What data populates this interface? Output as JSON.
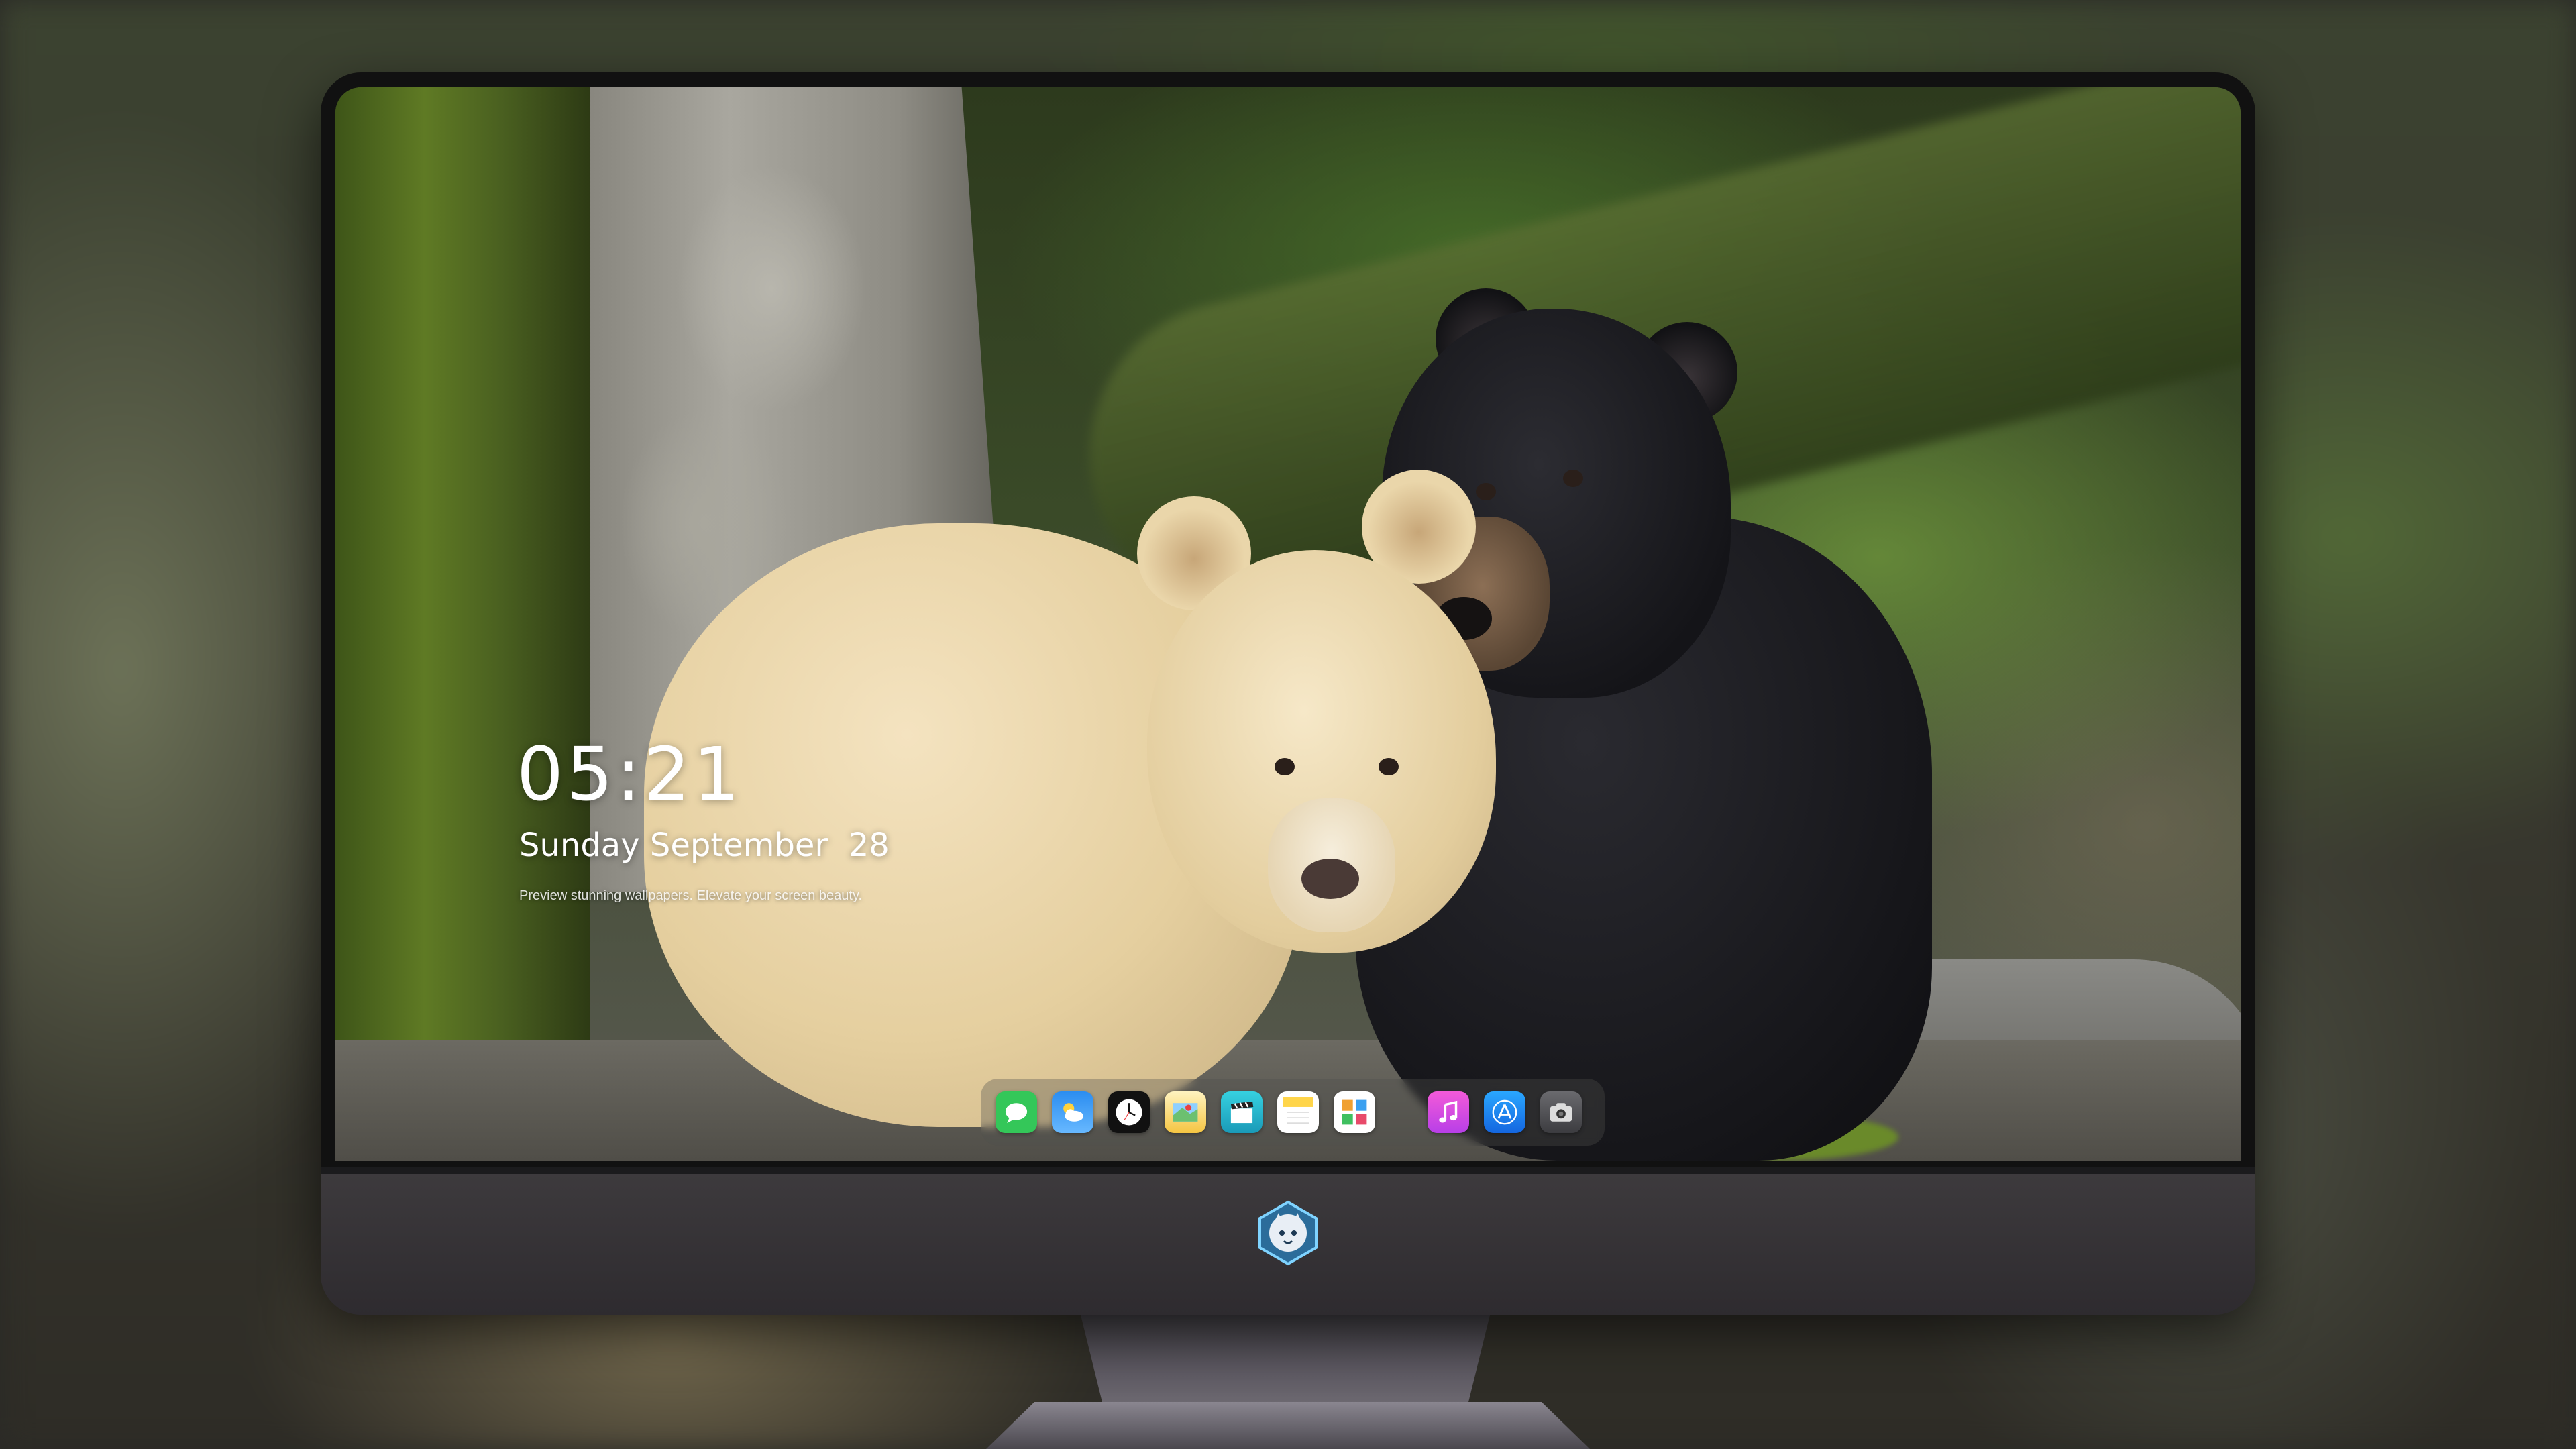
{
  "lockscreen": {
    "time": "05:21",
    "date": "Sunday September  28",
    "tagline": "Preview stunning wallpapers. Elevate your screen beauty."
  },
  "dock": {
    "apps": [
      {
        "name": "messages",
        "icon": "chat-bubble-icon",
        "color": "#34c759"
      },
      {
        "name": "weather",
        "icon": "cloud-sun-icon",
        "color": "#2b8df0"
      },
      {
        "name": "clock",
        "icon": "clock-icon",
        "color": "#ffffff"
      },
      {
        "name": "maps",
        "icon": "map-icon",
        "color": "#f5c542"
      },
      {
        "name": "videos",
        "icon": "clapperboard-icon",
        "color": "#2ec4d6"
      },
      {
        "name": "notes",
        "icon": "notes-icon",
        "color": "#ffd54a"
      },
      {
        "name": "photos-gallery",
        "icon": "gallery-icon",
        "color": "#f0a030"
      },
      {
        "name": "music",
        "icon": "music-note-icon",
        "color": "#d84be0"
      },
      {
        "name": "app-store",
        "icon": "app-store-icon",
        "color": "#1e90ff"
      },
      {
        "name": "camera",
        "icon": "camera-icon",
        "color": "#5a5a5e"
      }
    ]
  },
  "monitor": {
    "logo": "fox-mascot-logo"
  }
}
